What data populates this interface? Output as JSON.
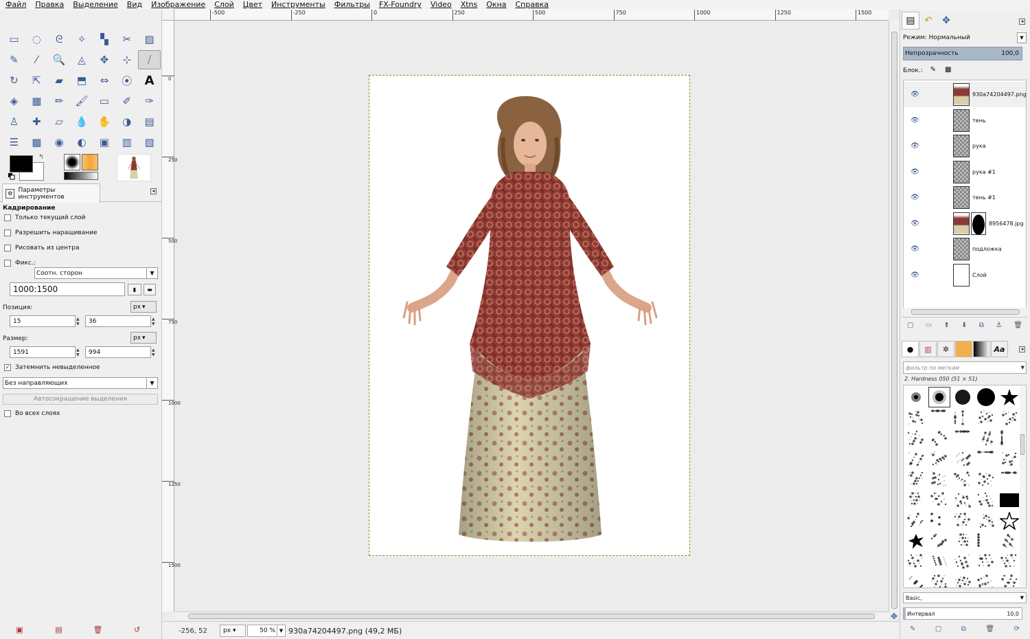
{
  "menu": [
    "Файл",
    "Правка",
    "Выделение",
    "Вид",
    "Изображение",
    "Слой",
    "Цвет",
    "Инструменты",
    "Фильтры",
    "FX-Foundry",
    "Video",
    "Xtns",
    "Окна",
    "Справка"
  ],
  "toolbox": {
    "tools": [
      [
        "rect-select-icon",
        "ellipse-select-icon",
        "free-select-icon",
        "fuzzy-select-icon",
        "color-select-icon",
        "scissors-icon",
        "foreground-select-icon"
      ],
      [
        "paths-icon",
        "color-picker-icon",
        "zoom-icon",
        "measure-icon",
        "move-icon",
        "align-icon",
        "crop-icon"
      ],
      [
        "rotate-icon",
        "scale-icon",
        "shear-icon",
        "perspective-icon",
        "flip-icon",
        "cage-icon",
        "text-icon"
      ],
      [
        "bucket-fill-icon",
        "blend-icon",
        "pencil-icon",
        "paintbrush-icon",
        "eraser-icon",
        "airbrush-icon",
        "ink-icon"
      ],
      [
        "clone-icon",
        "heal-icon",
        "perspective-clone-icon",
        "blur-icon",
        "smudge-icon",
        "dodge-burn-icon",
        "unified-transform-icon"
      ],
      [
        "levels-icon",
        "hue-icon",
        "color-balance-icon",
        "desaturate-icon",
        "script-icon",
        "histogram-icon",
        "filter-icon"
      ]
    ],
    "tool_glyphs": [
      [
        "▭",
        "◌",
        "ᘓ",
        "✧",
        "▚",
        "✂",
        "▨"
      ],
      [
        "✎",
        "⁄",
        "🔍",
        "◬",
        "✥",
        "⊹",
        "⧸"
      ],
      [
        "↻",
        "⇱",
        "▰",
        "⬒",
        "⇔",
        "⦿",
        "A"
      ],
      [
        "◈",
        "▦",
        "✏",
        "🖌",
        "▭",
        "✐",
        "✑"
      ],
      [
        "♙",
        "✚",
        "▱",
        "💧",
        "✋",
        "◑",
        "▤"
      ],
      [
        "☰",
        "▩",
        "◉",
        "◐",
        "▣",
        "▥",
        "▧"
      ]
    ],
    "active_tool": "crop-icon",
    "panel_tab_label": "Параметры инструментов",
    "panel_close": "◂",
    "options": {
      "title": "Кадрирование",
      "only_current_layer": "Только текущий слой",
      "allow_growing": "Разрешить наращивание",
      "expand_from_center": "Рисовать из центра",
      "fixed_label": "Фикс.:",
      "fixed_value": "Соотн. сторон",
      "ratio_value": "1000:1500",
      "position_label": "Позиция:",
      "position_unit": "px",
      "position_x": "15",
      "position_y": "36",
      "size_label": "Размер:",
      "size_unit": "px",
      "size_w": "1591",
      "size_h": "994",
      "highlight_label": "Затемнить невыделенное",
      "guides_value": "Без направляющих",
      "autoshrink_label": "Автосокращение выделения",
      "all_layers_label": "Во всех слоях"
    },
    "bottom_icons": [
      "save-options-icon",
      "restore-options-icon",
      "delete-options-icon",
      "reset-options-icon"
    ],
    "bottom_glyphs": [
      "▣",
      "▤",
      "🗑",
      "↺"
    ]
  },
  "canvas": {
    "hruler_labels": [
      "-500",
      "-250",
      "0",
      "250",
      "500",
      "750",
      "1000",
      "1250",
      "1500"
    ],
    "vruler_labels": [
      "0",
      "250",
      "500",
      "750",
      "1000",
      "1250",
      "1500"
    ],
    "status_coords": "-256, 52",
    "status_unit": "px",
    "status_zoom": "50 %",
    "status_file": "930a74204497.png (49,2 МБ)"
  },
  "layers_panel": {
    "mode_label": "Режим:",
    "mode_value": "Нормальный",
    "opacity_label": "Непрозрачность",
    "opacity_value": "100,0",
    "lock_label": "Блок.:",
    "layers": [
      {
        "name": "930a74204497.png",
        "selected": true,
        "thumb": "photo"
      },
      {
        "name": "тень",
        "thumb": "transparent"
      },
      {
        "name": "рука",
        "thumb": "transparent"
      },
      {
        "name": "рука #1",
        "thumb": "transparent"
      },
      {
        "name": "тень #1",
        "thumb": "transparent"
      },
      {
        "name": "8956478.jpg",
        "thumb": "photo-mask"
      },
      {
        "name": "подложка",
        "thumb": "transparent"
      },
      {
        "name": "Слой",
        "thumb": "white"
      }
    ]
  },
  "brushes_panel": {
    "filter_placeholder": "фильтр по меткам",
    "selected_brush": "2. Hardness 050 (51 × 51)",
    "preset_value": "Basic,",
    "spacing_label": "Интервал",
    "spacing_value": "10,0",
    "tab_text": "Aa"
  },
  "colors": {
    "foreground": "#000000",
    "background": "#ffffff",
    "selection_border": "#8a8a2a"
  }
}
